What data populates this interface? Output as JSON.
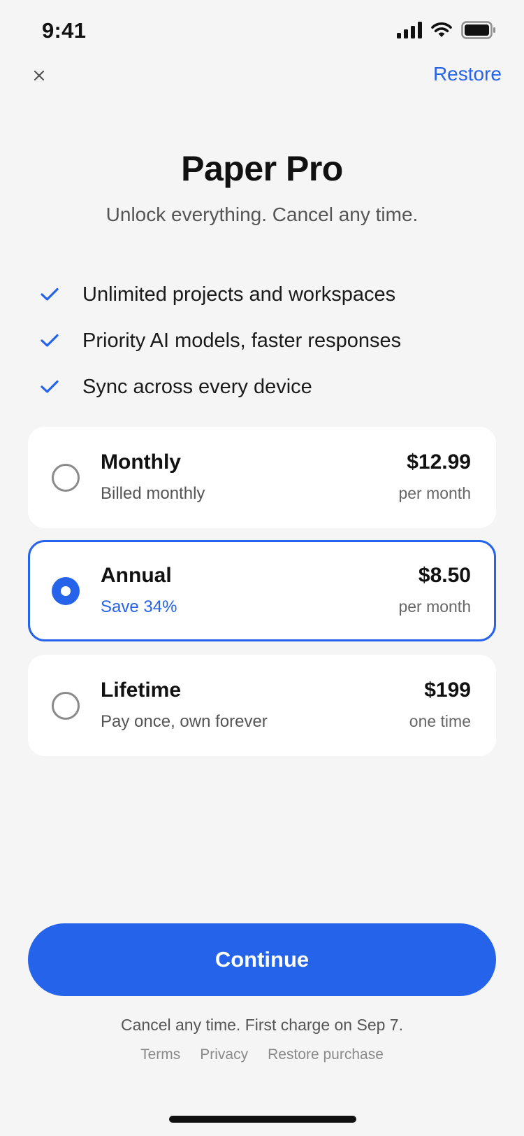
{
  "status_bar": {
    "time": "9:41",
    "icons": [
      "cellular-signal-icon",
      "wifi-icon",
      "battery-icon"
    ]
  },
  "nav": {
    "close_icon": "close-icon",
    "close_glyph": "×",
    "restore_label": "Restore"
  },
  "header": {
    "title": "Paper Pro",
    "subtitle": "Unlock everything. Cancel any time."
  },
  "features": [
    {
      "icon": "checkmark-icon",
      "label": "Unlimited projects and workspaces"
    },
    {
      "icon": "checkmark-icon",
      "label": "Priority AI models, faster responses"
    },
    {
      "icon": "checkmark-icon",
      "label": "Sync across every device"
    }
  ],
  "plans": [
    {
      "name": "Monthly",
      "description": "Billed monthly",
      "price": "$12.99",
      "period": "per month",
      "selected": false
    },
    {
      "name": "Annual",
      "description": "Save 34%",
      "price": "$8.50",
      "period": "per month",
      "selected": true
    },
    {
      "name": "Lifetime",
      "description": "Pay once, own forever",
      "price": "$199",
      "period": "one time",
      "selected": false
    }
  ],
  "cta": {
    "label": "Continue"
  },
  "footer": {
    "fine_print": "Cancel any time. First charge on Sep 7.",
    "links": [
      "Terms",
      "Privacy",
      "Restore purchase"
    ]
  },
  "colors": {
    "accent": "#2563eb",
    "background": "#f5f5f5",
    "card": "#ffffff"
  }
}
